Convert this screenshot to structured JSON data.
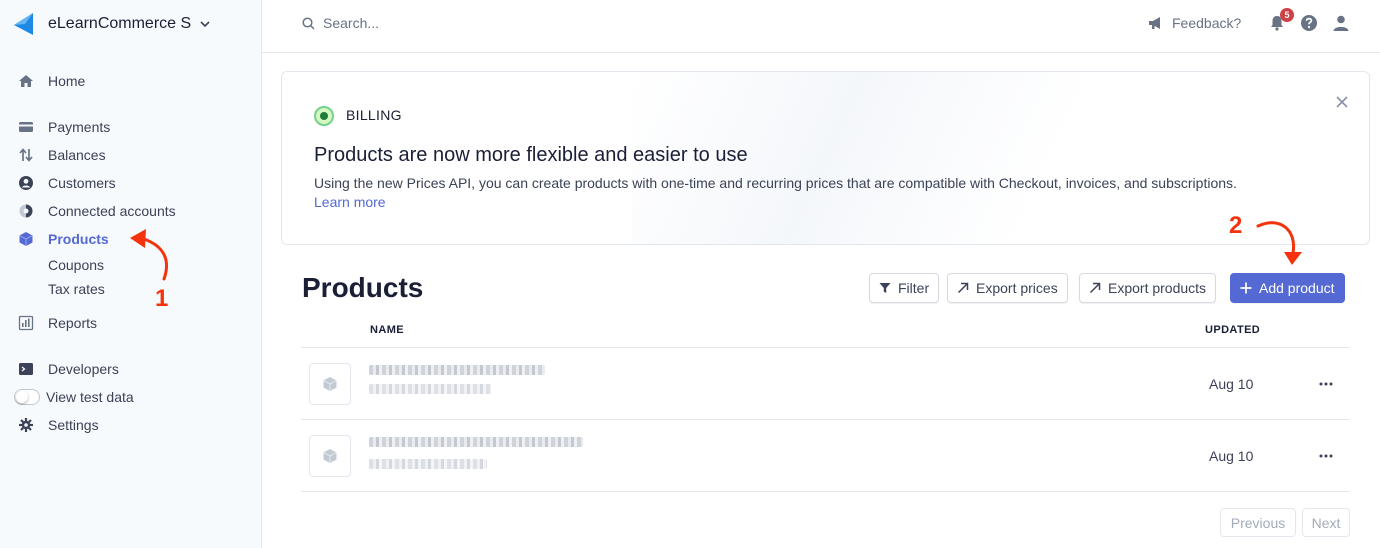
{
  "sidebar": {
    "account_name": "eLearnCommerce S",
    "items": [
      {
        "label": "Home",
        "icon": "home-icon"
      },
      {
        "label": "Payments",
        "icon": "payments-icon"
      },
      {
        "label": "Balances",
        "icon": "balances-icon"
      },
      {
        "label": "Customers",
        "icon": "customers-icon"
      },
      {
        "label": "Connected accounts",
        "icon": "connected-accounts-icon"
      },
      {
        "label": "Products",
        "icon": "products-icon",
        "active": true
      },
      {
        "label": "Reports",
        "icon": "reports-icon"
      },
      {
        "label": "Developers",
        "icon": "terminal-icon"
      },
      {
        "label": "View test data",
        "icon": "toggle"
      },
      {
        "label": "Settings",
        "icon": "gear-icon"
      }
    ],
    "sub_items": [
      "Coupons",
      "Tax rates"
    ]
  },
  "topbar": {
    "search_placeholder": "Search...",
    "feedback_label": "Feedback?",
    "notification_count": "5"
  },
  "banner": {
    "label": "BILLING",
    "title": "Products are now more flexible and easier to use",
    "description": "Using the new Prices API, you can create products with one-time and recurring prices that are compatible with Checkout, invoices, and subscriptions.",
    "link": "Learn more"
  },
  "main": {
    "title": "Products",
    "buttons": {
      "filter": "Filter",
      "export_prices": "Export prices",
      "export_products": "Export products",
      "add_product": "Add product"
    },
    "table": {
      "columns": [
        "NAME",
        "UPDATED"
      ],
      "rows": [
        {
          "updated": "Aug 10"
        },
        {
          "updated": "Aug 10"
        }
      ]
    },
    "pagination": {
      "previous": "Previous",
      "next": "Next"
    }
  },
  "annotations": {
    "step1": "1",
    "step2": "2"
  },
  "colors": {
    "accent": "#5469d4",
    "annotation": "#f4330c",
    "sidebar_bg": "#f7fafc"
  }
}
